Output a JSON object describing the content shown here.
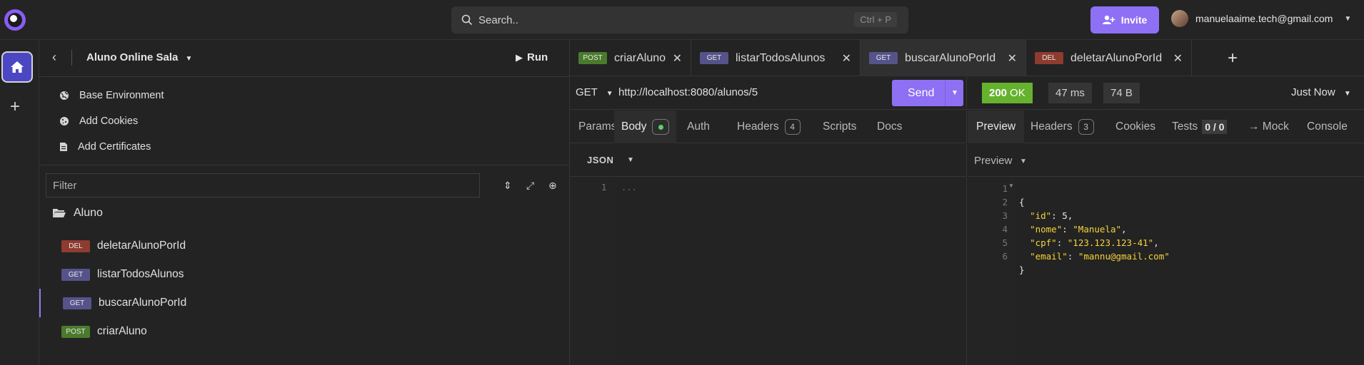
{
  "topbar": {
    "search_label": "Search..",
    "search_shortcut": "Ctrl + P",
    "invite_label": "Invite",
    "user_email": "manuelaaime.tech@gmail.com"
  },
  "sidebar": {
    "collection_title": "Aluno Online Sala",
    "run_label": "Run",
    "menu": [
      {
        "label": "Base Environment",
        "icon": "globe-icon"
      },
      {
        "label": "Add Cookies",
        "icon": "cookie-icon"
      },
      {
        "label": "Add Certificates",
        "icon": "certificate-icon"
      }
    ],
    "filter_placeholder": "Filter",
    "folder_name": "Aluno",
    "requests": [
      {
        "method": "DEL",
        "name": "deletarAlunoPorId"
      },
      {
        "method": "GET",
        "name": "listarTodosAlunos"
      },
      {
        "method": "GET",
        "name": "buscarAlunoPorId",
        "active": true
      },
      {
        "method": "POST",
        "name": "criarAluno"
      }
    ]
  },
  "tabs": [
    {
      "method": "POST",
      "name": "criarAluno"
    },
    {
      "method": "GET",
      "name": "listarTodosAlunos"
    },
    {
      "method": "GET",
      "name": "buscarAlunoPorId",
      "active": true
    },
    {
      "method": "DEL",
      "name": "deletarAlunoPorId"
    }
  ],
  "request": {
    "method": "GET",
    "url": "http://localhost:8080/alunos/5",
    "send_label": "Send",
    "subtabs": {
      "params": "Params",
      "body": "Body",
      "auth": "Auth",
      "headers": "Headers",
      "headers_count": "4",
      "scripts": "Scripts",
      "docs": "Docs"
    },
    "body_type": "JSON",
    "editor_line": "1",
    "editor_placeholder": "..."
  },
  "response": {
    "status_code": "200",
    "status_text": "OK",
    "time": "47 ms",
    "size": "74 B",
    "when": "Just Now",
    "subtabs": {
      "preview": "Preview",
      "headers": "Headers",
      "headers_count": "3",
      "cookies": "Cookies",
      "tests": "Tests",
      "tests_count": "0 / 0",
      "mock": "→ Mock",
      "console": "Console"
    },
    "preview_mode": "Preview",
    "line_numbers": [
      "1",
      "2",
      "3",
      "4",
      "5",
      "6"
    ],
    "json": {
      "open": "{",
      "lines": [
        {
          "key": "\"id\"",
          "value": "5",
          "comma": ","
        },
        {
          "key": "\"nome\"",
          "value": "\"Manuela\"",
          "comma": ","
        },
        {
          "key": "\"cpf\"",
          "value": "\"123.123.123-41\"",
          "comma": ","
        },
        {
          "key": "\"email\"",
          "value": "\"mannu@gmail.com\"",
          "comma": ""
        }
      ],
      "close": "}"
    }
  },
  "colors": {
    "accent": "#8e70f4",
    "ok_green": "#66b22e",
    "del_badge": "#8e3b30",
    "get_badge": "#55538a",
    "post_badge": "#4a7b2d"
  }
}
